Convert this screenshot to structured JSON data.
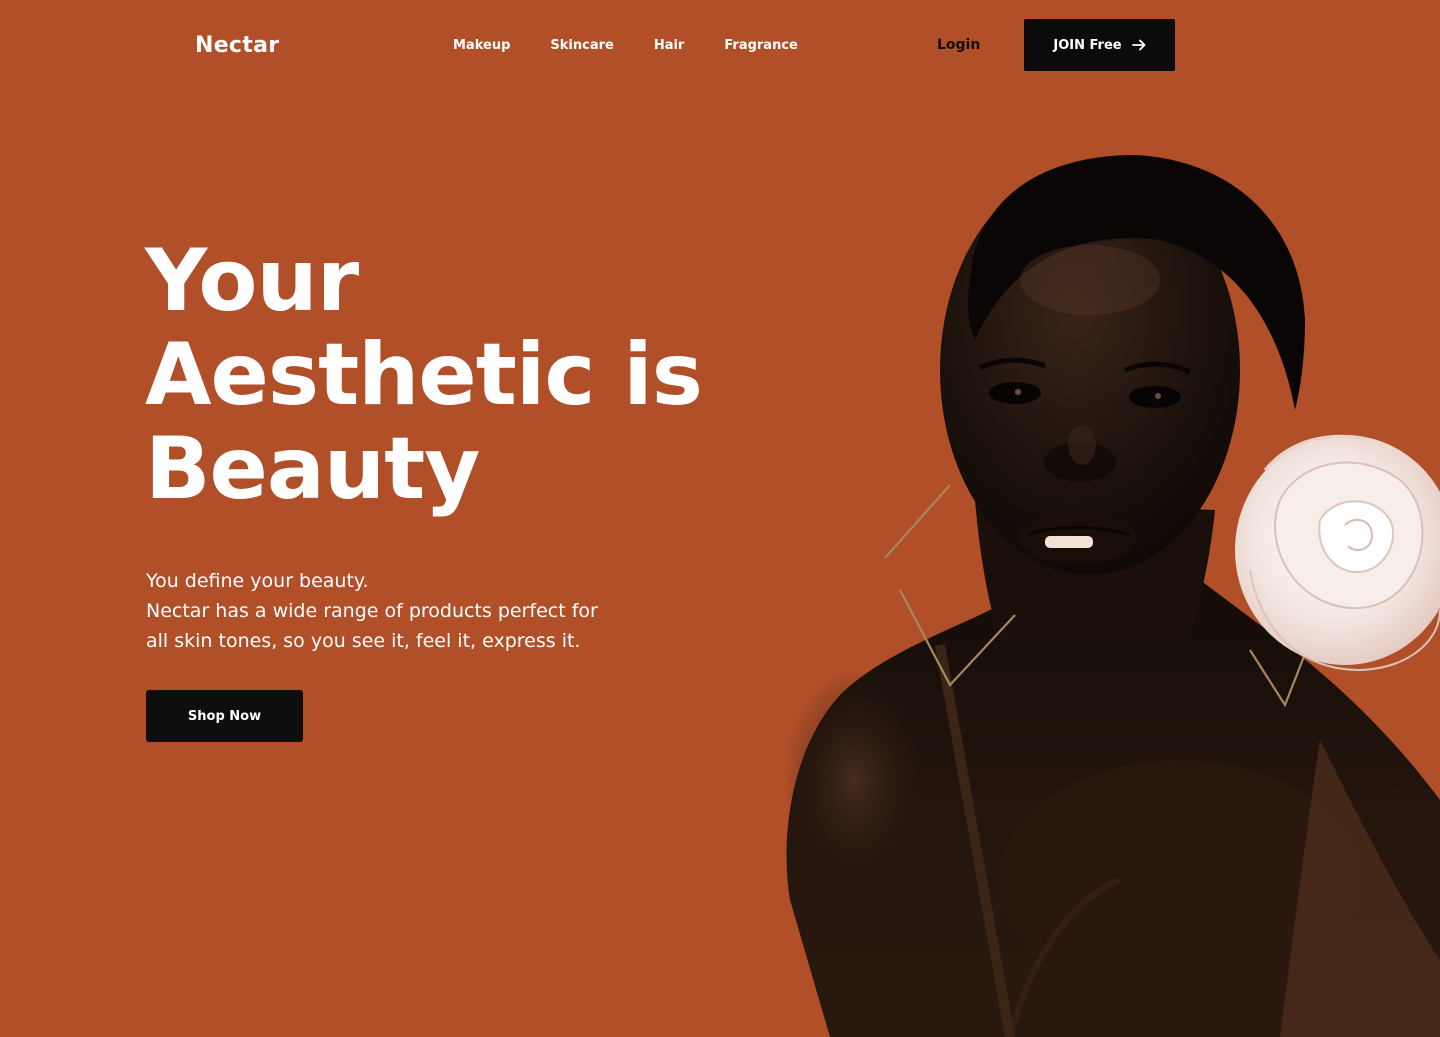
{
  "brand": {
    "name": "Nectar"
  },
  "nav": {
    "items": [
      {
        "label": "Makeup"
      },
      {
        "label": "Skincare"
      },
      {
        "label": "Hair"
      },
      {
        "label": "Fragrance"
      }
    ]
  },
  "header": {
    "login_label": "Login",
    "join_label": "JOIN Free",
    "join_icon": "arrow-right-icon"
  },
  "hero": {
    "headline_lines": [
      "Your",
      "Aesthetic is",
      "Beauty"
    ],
    "subcopy_lines": [
      "You define your beauty.",
      "Nectar has a wide range of products perfect for",
      "all skin tones, so you see it, feel it, express it."
    ],
    "cta_label": "Shop Now",
    "image_subject": "portrait-model-with-rose"
  },
  "colors": {
    "background": "#B04F28",
    "button": "#0B0B0B",
    "text_light": "#FFFFFF",
    "text_dark": "#111111"
  }
}
